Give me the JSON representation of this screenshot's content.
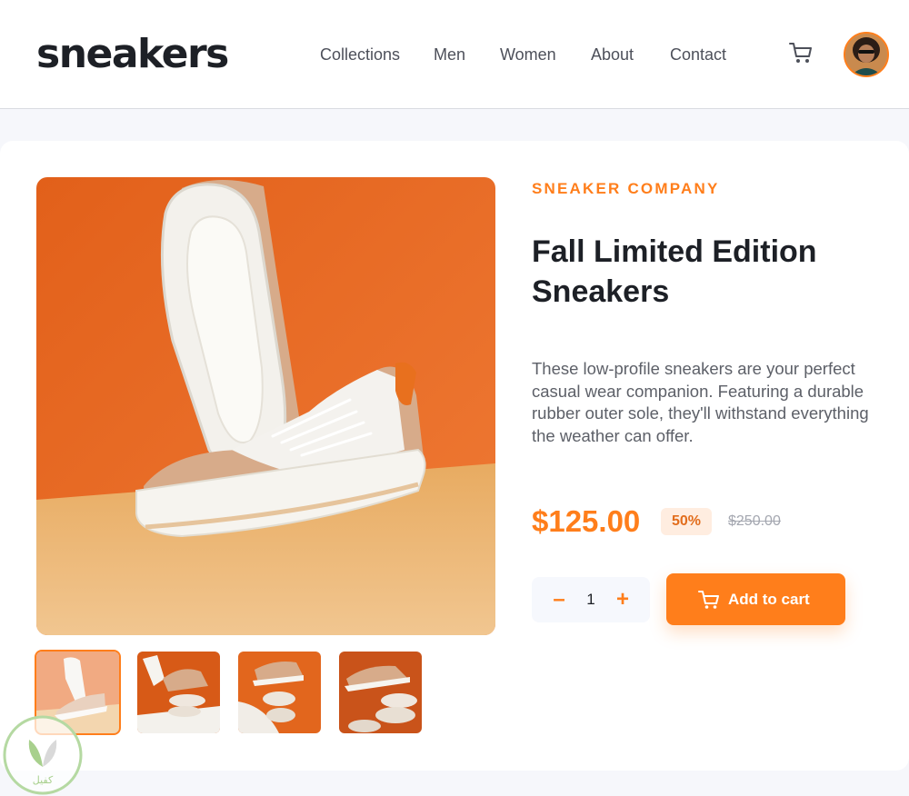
{
  "header": {
    "logo": "sneakers",
    "nav": [
      "Collections",
      "Men",
      "Women",
      "About",
      "Contact"
    ],
    "cart_icon": "cart-icon",
    "avatar_icon": "avatar-icon"
  },
  "product": {
    "company": "SNEAKER COMPANY",
    "title": "Fall Limited Edition Sneakers",
    "description": "These low-profile sneakers are your perfect casual wear companion. Featuring a durable rubber outer sole, they'll withstand everything the weather can offer.",
    "price": "$125.00",
    "discount": "50%",
    "original_price": "$250.00",
    "quantity": "1",
    "minus_label": "–",
    "plus_label": "+",
    "add_to_cart": "Add to cart",
    "thumbnail_count": 4,
    "active_thumbnail": 1
  },
  "colors": {
    "accent": "#ff7e1b",
    "accent_pale": "#ffede0",
    "text_dark": "#1d2026",
    "text_gray": "#5d6068",
    "image_orange": "#e8661a",
    "image_floor": "#eab46e"
  },
  "watermark": {
    "text": "كفيل"
  }
}
